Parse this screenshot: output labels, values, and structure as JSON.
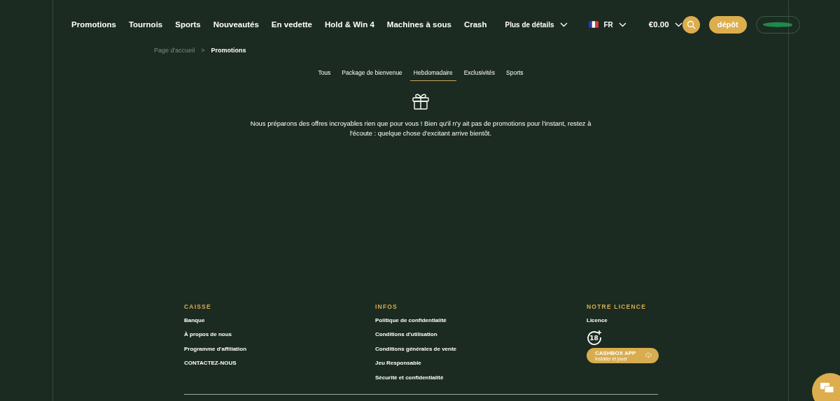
{
  "header": {
    "nav": [
      "Promotions",
      "Tournois",
      "Sports",
      "Nouveautés",
      "En vedette",
      "Hold & Win 4",
      "Machines à sous",
      "Crash"
    ],
    "more": "Plus de détails",
    "language": "FR",
    "balance": "€0.00",
    "deposit": "dépôt"
  },
  "breadcrumb_separator": ">",
  "breadcrumb": [
    {
      "label": "Page d'accueil",
      "selected": false
    },
    {
      "label": "Promotions",
      "selected": true
    }
  ],
  "tabs": [
    {
      "label": "Tous",
      "selected": false
    },
    {
      "label": "Package de bienvenue",
      "selected": false
    },
    {
      "label": "Hebdomadaire",
      "selected": true
    },
    {
      "label": "Exclusivités",
      "selected": false
    },
    {
      "label": "Sports",
      "selected": false
    }
  ],
  "empty_message": "Nous préparons des offres incroyables rien que pour vous ! Bien qu'il n'y ait pas de promotions pour l'instant, restez à l'écoute : quelque chose d'excitant arrive bientôt.",
  "footer": {
    "columns": [
      {
        "title": "CAISSE",
        "links": [
          "Banque",
          "À propos de nous",
          "Programme d'affiliation",
          "CONTACTEZ-NOUS"
        ]
      },
      {
        "title": "INFOS",
        "links": [
          "Politique de confidentialité",
          "Conditions d'utilisation",
          "Conditions générales de vente",
          "Jeu Responsable",
          "Sécurité et confidentialité"
        ]
      },
      {
        "title": "NOTRE LICENCE",
        "links": [
          "Licence"
        ],
        "age_badge": "18",
        "app_button": {
          "title": "CASHBOX APP",
          "subtitle": "Installer et jouer"
        }
      }
    ]
  }
}
